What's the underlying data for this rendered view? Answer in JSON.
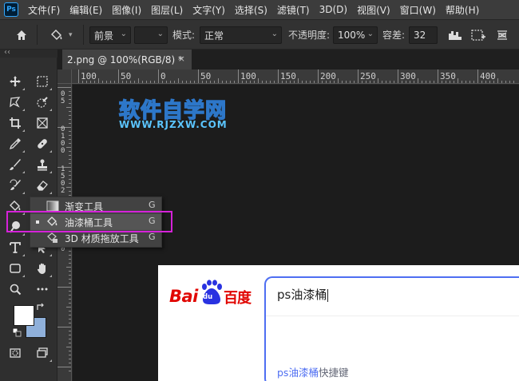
{
  "app": {
    "logo": "Ps"
  },
  "menu": [
    "文件(F)",
    "编辑(E)",
    "图像(I)",
    "图层(L)",
    "文字(Y)",
    "选择(S)",
    "滤镜(T)",
    "3D(D)",
    "视图(V)",
    "窗口(W)",
    "帮助(H)"
  ],
  "options": {
    "fill_source": "前景",
    "mode_label": "模式:",
    "mode_value": "正常",
    "opacity_label": "不透明度:",
    "opacity_value": "100%",
    "tolerance_label": "容差:",
    "tolerance_value": "32"
  },
  "panel": {
    "collapse": "‹‹"
  },
  "document": {
    "tab_title": "2.png @ 100%(RGB/8) *",
    "close": "×"
  },
  "ruler": {
    "h_labels": [
      "100",
      "50",
      "0",
      "50",
      "100",
      "150",
      "200",
      "250",
      "300",
      "350",
      "400"
    ],
    "v_labels": [
      "0",
      "5",
      "0",
      "1",
      "0",
      "0",
      "1",
      "5",
      "0",
      "2",
      "0",
      "0",
      "2",
      "5",
      "0"
    ]
  },
  "canvas": {
    "watermark_title": "软件自学网",
    "watermark_url": "WWW.RJZXW.COM"
  },
  "flyout": {
    "items": [
      {
        "label": "渐变工具",
        "shortcut": "G",
        "icon": "gradient-icon"
      },
      {
        "label": "油漆桶工具",
        "shortcut": "G",
        "icon": "paint-bucket-icon",
        "active": true
      },
      {
        "label": "3D 材质拖放工具",
        "shortcut": "G",
        "icon": "material-drop-icon"
      }
    ]
  },
  "colors": {
    "foreground": "#ffffff",
    "background": "#8fb0da",
    "highlight": "#d522d9"
  },
  "baidu": {
    "logo_bai": "Bai",
    "logo_du": "du",
    "logo_baidu": "百度",
    "query": "ps油漆桶",
    "suggestion_prefix": "ps油漆桶",
    "suggestion_suffix": "快捷键"
  }
}
